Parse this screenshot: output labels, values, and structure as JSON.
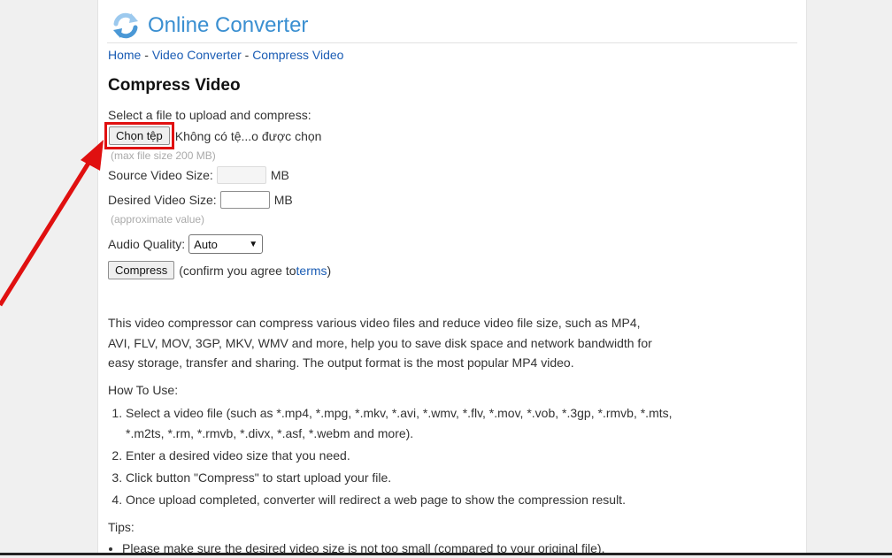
{
  "site": {
    "name": "Online Converter",
    "logo_icon": "refresh-arrows-icon"
  },
  "breadcrumb": {
    "home": "Home",
    "sep1": " - ",
    "video_converter": "Video Converter",
    "sep2": " - ",
    "compress_video": "Compress Video"
  },
  "title": "Compress Video",
  "form": {
    "select_label": "Select a file to upload and compress:",
    "file_button": "Chọn tệp",
    "file_status": "Không có tệ...o được chọn",
    "max_size_hint": "(max file size 200 MB)",
    "source_size_label": "Source Video Size:",
    "source_size_unit": "MB",
    "desired_size_label": "Desired Video Size:",
    "desired_size_unit": "MB",
    "desired_size_value": "",
    "approx_hint": "(approximate value)",
    "audio_quality_label": "Audio Quality:",
    "audio_quality_selected": "Auto",
    "compress_button": "Compress",
    "confirm_prefix": "(confirm you agree to ",
    "terms_link": "terms",
    "confirm_suffix": ")"
  },
  "description": "This video compressor can compress various video files and reduce video file size, such as MP4, AVI, FLV, MOV, 3GP, MKV, WMV and more, help you to save disk space and network bandwidth for easy storage, transfer and sharing. The output format is the most popular MP4 video.",
  "how_to": {
    "heading": "How To Use:",
    "steps": [
      "Select a video file (such as *.mp4, *.mpg, *.mkv, *.avi, *.wmv, *.flv, *.mov, *.vob, *.3gp, *.rmvb, *.mts, *.m2ts, *.rm, *.rmvb, *.divx, *.asf, *.webm and more).",
      "Enter a desired video size that you need.",
      "Click button \"Compress\" to start upload your file.",
      "Once upload completed, converter will redirect a web page to show the compression result."
    ]
  },
  "tips": {
    "heading": "Tips:",
    "items": [
      "Please make sure the desired video size is not too small (compared to your original file)."
    ]
  },
  "colors": {
    "brand": "#3a8fd1",
    "link": "#1a5cb4",
    "highlight": "#e01010"
  }
}
